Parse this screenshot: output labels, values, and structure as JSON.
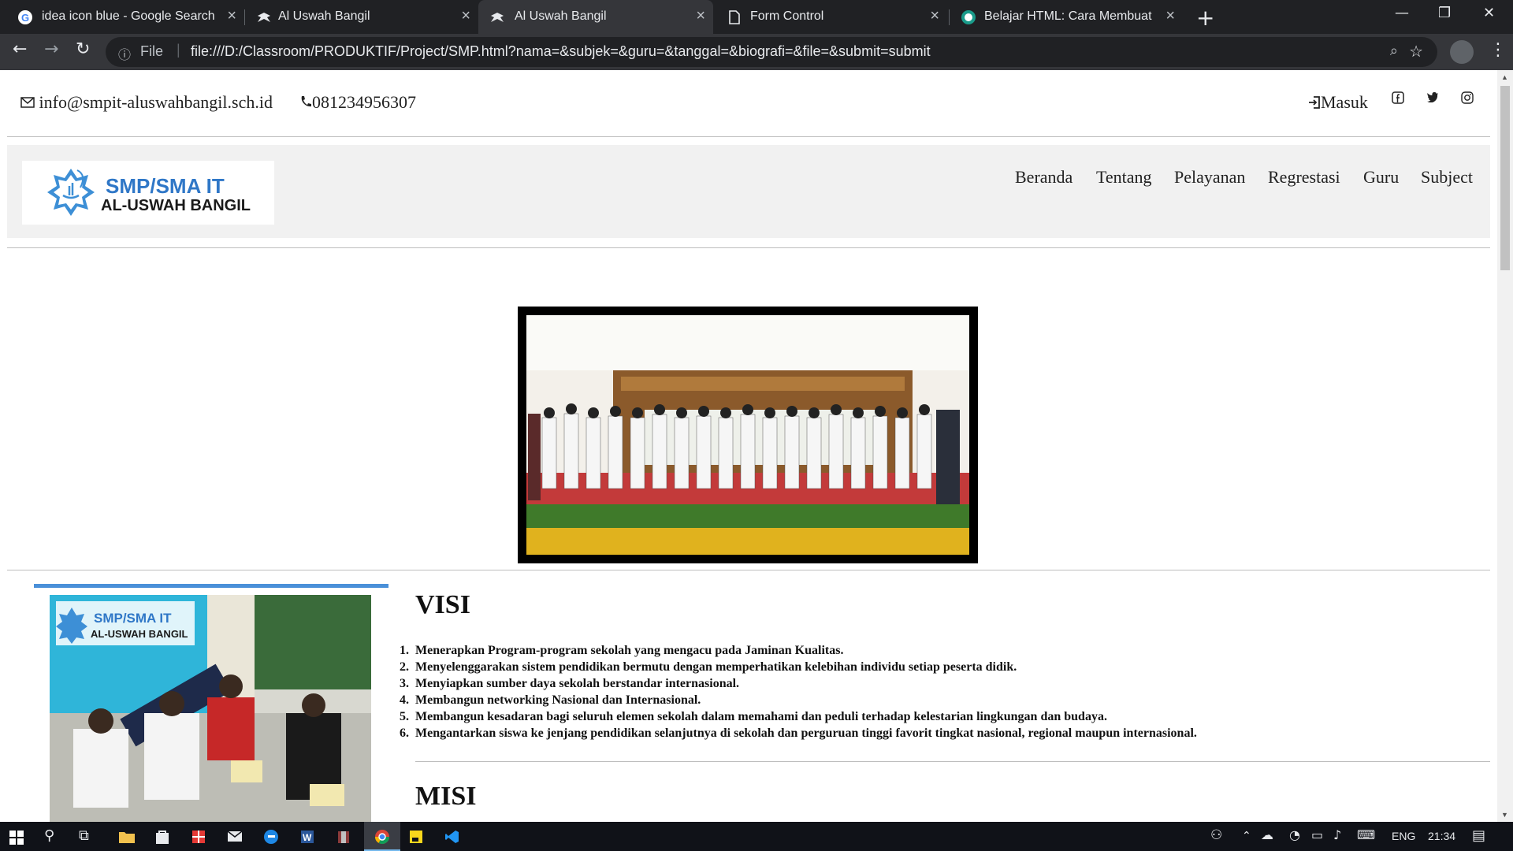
{
  "browser": {
    "tabs": [
      {
        "title": "idea icon blue - Google Search"
      },
      {
        "title": "Al Uswah Bangil"
      },
      {
        "title": "Al Uswah Bangil"
      },
      {
        "title": "Form Control"
      },
      {
        "title": "Belajar HTML: Cara Membuat For"
      }
    ],
    "file_label": "File",
    "url": "file:///D:/Classroom/PRODUKTIF/Project/SMP.html?nama=&subjek=&guru=&tanggal=&biografi=&file=&submit=submit"
  },
  "topbar": {
    "email": "info@smpit-aluswahbangil.sch.id",
    "phone": "081234956307",
    "login": "Masuk"
  },
  "logo": {
    "line1": "SMP/SMA IT",
    "line2": "AL-USWAH BANGIL"
  },
  "nav": {
    "items": [
      "Beranda",
      "Tentang",
      "Pelayanan",
      "Regrestasi",
      "Guru",
      "Subject"
    ]
  },
  "visi": {
    "heading": "VISI",
    "items": [
      "Menerapkan Program-program sekolah yang mengacu pada Jaminan Kualitas.",
      "Menyelenggarakan sistem pendidikan bermutu dengan memperhatikan kelebihan individu setiap peserta didik.",
      "Menyiapkan sumber daya sekolah berstandar internasional.",
      "Membangun networking Nasional dan Internasional.",
      "Membangun kesadaran bagi seluruh elemen sekolah dalam memahami dan peduli terhadap kelestarian lingkungan dan budaya.",
      "Mengantarkan siswa ke jenjang pendidikan selanjutnya di sekolah dan perguruan tinggi favorit tingkat nasional, regional maupun internasional."
    ]
  },
  "misi": {
    "heading": "MISI"
  },
  "taskbar": {
    "language": "ENG",
    "time": "21:34"
  },
  "colors": {
    "browser_dark": "#202124",
    "toolbar": "#35363a",
    "navbar_bg": "#f1f1f1",
    "logo_blue": "#2f77c7",
    "accent_bar": "#4a90d9"
  },
  "icons": [
    "google-favicon",
    "bird-favicon",
    "document-favicon",
    "globe-favicon",
    "envelope-icon",
    "phone-icon",
    "login-icon",
    "facebook-icon",
    "twitter-icon",
    "instagram-icon",
    "windows-start-icon",
    "search-icon",
    "chrome-icon",
    "vscode-icon"
  ]
}
